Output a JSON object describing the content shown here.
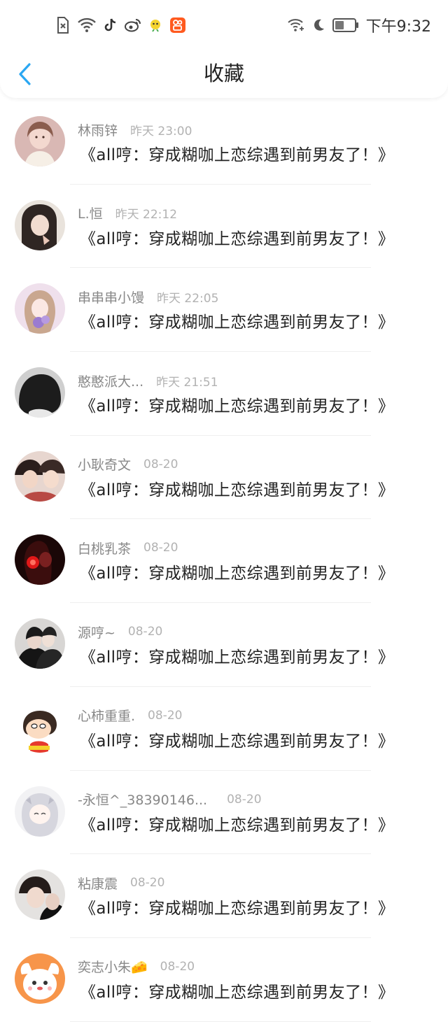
{
  "status_bar": {
    "time": "下午9:32",
    "left_icons": [
      "sim-error-icon",
      "wifi-icon",
      "tiktok-icon",
      "weibo-icon",
      "chat-bird-icon",
      "kuaishou-icon"
    ],
    "right_icons": [
      "wifi-plus-icon",
      "moon-icon",
      "battery-icon"
    ]
  },
  "nav": {
    "title": "收藏",
    "back_icon": "chevron-left-icon"
  },
  "colors": {
    "accent": "#2aa7f2",
    "username": "#888888",
    "time": "#b2b2b2",
    "title": "#222222"
  },
  "items": [
    {
      "user": "林雨锌",
      "time": "昨天 23:00",
      "title": "《all哼：穿成糊咖上恋综遇到前男友了！》"
    },
    {
      "user": "L.恒",
      "time": "昨天 22:12",
      "title": "《all哼：穿成糊咖上恋综遇到前男友了！》"
    },
    {
      "user": "串串串小馒",
      "time": "昨天 22:05",
      "title": "《all哼：穿成糊咖上恋综遇到前男友了！》"
    },
    {
      "user": "憨憨派大...",
      "time": "昨天 21:51",
      "title": "《all哼：穿成糊咖上恋综遇到前男友了！》"
    },
    {
      "user": "小耿奇文",
      "time": "08-20",
      "title": "《all哼：穿成糊咖上恋综遇到前男友了！》"
    },
    {
      "user": "白桃乳茶",
      "time": "08-20",
      "title": "《all哼：穿成糊咖上恋综遇到前男友了！》"
    },
    {
      "user": "源哼~",
      "time": "08-20",
      "title": "《all哼：穿成糊咖上恋综遇到前男友了！》"
    },
    {
      "user": "心柿重重.",
      "time": "08-20",
      "title": "《all哼：穿成糊咖上恋综遇到前男友了！》"
    },
    {
      "user": "-永恒^_38390146...",
      "time": "08-20",
      "title": "《all哼：穿成糊咖上恋综遇到前男友了！》"
    },
    {
      "user": "粘康震",
      "time": "08-20",
      "title": "《all哼：穿成糊咖上恋综遇到前男友了！》"
    },
    {
      "user": "奕志小朱🧀",
      "time": "08-20",
      "title": "《all哼：穿成糊咖上恋综遇到前男友了！》"
    }
  ]
}
